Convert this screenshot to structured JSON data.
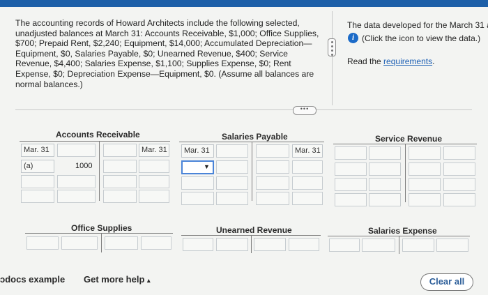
{
  "problem": {
    "intro": "The accounting records of Howard Architects include the following selected, unadjusted balances at March 31: Accounts Receivable, $1,000; Office Supplies, $700; Prepaid Rent, $2,240; Equipment, $14,000; Accumulated Depreciation—Equipment, $0, Salaries Payable, $0; Unearned Revenue, $400; Service Revenue, $4,400; Salaries Expense, $1,100; Supplies Expense, $0; Rent Expense, $0; Depreciation Expense—Equipment, $0. (Assume all balances are normal balances.)"
  },
  "side_panel": {
    "data_line": "The data developed for the March 31 a",
    "info_icon": "info-icon",
    "icon_hint": "(Click the icon to view the data.)",
    "read_prefix": "Read the ",
    "requirements_link": "requirements",
    "read_suffix": "."
  },
  "more_button": "•••",
  "accounts": {
    "accounts_receivable": {
      "title": "Accounts Receivable",
      "row1_left": "Mar. 31",
      "row1_right": "Mar. 31",
      "row2_left": "(a)",
      "row2_value": "1000"
    },
    "salaries_payable": {
      "title": "Salaries Payable",
      "row1_left": "Mar. 31",
      "row1_right": "Mar. 31",
      "dropdown_selected": ""
    },
    "service_revenue": {
      "title": "Service Revenue"
    },
    "office_supplies": {
      "title": "Office Supplies"
    },
    "unearned_revenue": {
      "title": "Unearned Revenue"
    },
    "salaries_expense": {
      "title": "Salaries Expense"
    }
  },
  "footer": {
    "example": "ɔdocs example",
    "help": "Get more help",
    "help_caret": "▴",
    "clear": "Clear all"
  },
  "colors": {
    "accent": "#1c6bc8",
    "link": "#1c5fb4",
    "top_bar": "#1d5fa8"
  }
}
